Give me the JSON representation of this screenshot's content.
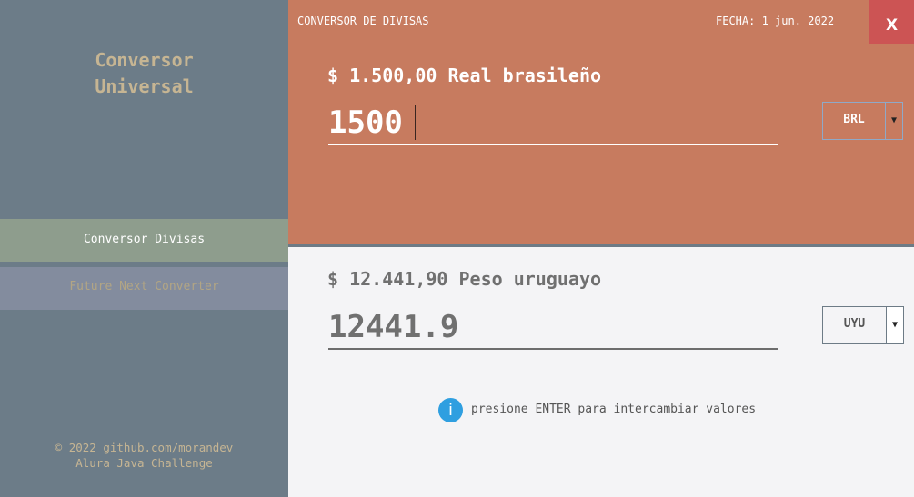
{
  "sidebar": {
    "title_line1": "Conversor",
    "title_line2": "Universal",
    "items": [
      {
        "label": "Conversor Divisas"
      },
      {
        "label": "Future Next Converter"
      }
    ],
    "footer_line1": "© 2022 github.com/morandev",
    "footer_line2": "Alura Java Challenge"
  },
  "header": {
    "title": "CONVERSOR DE DIVISAS",
    "date": "FECHA: 1 jun. 2022",
    "close_label": "X"
  },
  "from": {
    "label": "$ 1.500,00 Real brasileño",
    "value": "1500",
    "currency": "BRL"
  },
  "to": {
    "label": "$ 12.441,90 Peso uruguayo",
    "value": "12441.9",
    "currency": "UYU"
  },
  "hint": {
    "icon": "info-icon",
    "text": "presione ENTER para intercambiar valores"
  },
  "colors": {
    "sidebar_bg": "#6c7c88",
    "accent_top": "#c77b5f",
    "nav_active": "#8e9d8d",
    "nav_inactive": "#838c9e",
    "close_button": "#cc5454",
    "info_blue": "#2f9fe0",
    "title_gold": "#c6b593"
  }
}
